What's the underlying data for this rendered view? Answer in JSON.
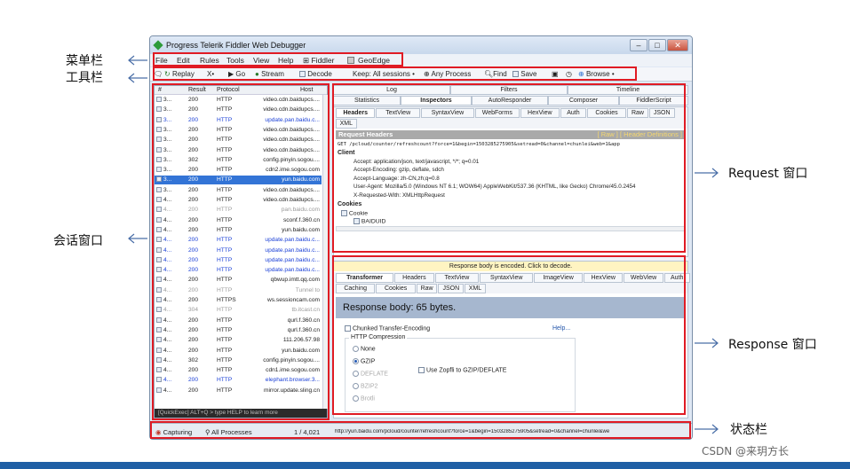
{
  "title": "Progress Telerik Fiddler Web Debugger",
  "menu": [
    "File",
    "Edit",
    "Rules",
    "Tools",
    "View",
    "Help",
    "⊞ Fiddler",
    "GeoEdge"
  ],
  "toolbar": {
    "replay": "Replay",
    "x": "X•",
    "go": "▶ Go",
    "stream": "Stream",
    "decode": "Decode",
    "keep": "Keep: All sessions •",
    "process": "Any Process",
    "find": "Find",
    "save": "Save",
    "browse": "Browse •"
  },
  "sessions_header": {
    "num": "#",
    "result": "Result",
    "protocol": "Protocol",
    "host": "Host"
  },
  "sessions": [
    {
      "id": "3...",
      "result": "200",
      "protocol": "HTTP",
      "host": "video.cdn.baidupcs....",
      "style": "n"
    },
    {
      "id": "3...",
      "result": "200",
      "protocol": "HTTP",
      "host": "video.cdn.baidupcs....",
      "style": "n"
    },
    {
      "id": "3...",
      "result": "200",
      "protocol": "HTTP",
      "host": "update.pan.baidu.c...",
      "style": "b"
    },
    {
      "id": "3...",
      "result": "200",
      "protocol": "HTTP",
      "host": "video.cdn.baidupcs....",
      "style": "n"
    },
    {
      "id": "3...",
      "result": "200",
      "protocol": "HTTP",
      "host": "video.cdn.baidupcs....",
      "style": "n"
    },
    {
      "id": "3...",
      "result": "200",
      "protocol": "HTTP",
      "host": "video.cdn.baidupcs....",
      "style": "n"
    },
    {
      "id": "3...",
      "result": "302",
      "protocol": "HTTP",
      "host": "config.pinyin.sogou....",
      "style": "n"
    },
    {
      "id": "3...",
      "result": "200",
      "protocol": "HTTP",
      "host": "cdn2.ime.sogou.com",
      "style": "n"
    },
    {
      "id": "3...",
      "result": "200",
      "protocol": "HTTP",
      "host": "yun.baidu.com",
      "style": "s"
    },
    {
      "id": "3...",
      "result": "200",
      "protocol": "HTTP",
      "host": "video.cdn.baidupcs....",
      "style": "n"
    },
    {
      "id": "4...",
      "result": "200",
      "protocol": "HTTP",
      "host": "video.cdn.baidupcs....",
      "style": "n"
    },
    {
      "id": "4...",
      "result": "200",
      "protocol": "HTTP",
      "host": "pan.baidu.com",
      "style": "g"
    },
    {
      "id": "4...",
      "result": "200",
      "protocol": "HTTP",
      "host": "sconf.f.360.cn",
      "style": "n"
    },
    {
      "id": "4...",
      "result": "200",
      "protocol": "HTTP",
      "host": "yun.baidu.com",
      "style": "n"
    },
    {
      "id": "4...",
      "result": "200",
      "protocol": "HTTP",
      "host": "update.pan.baidu.c...",
      "style": "b"
    },
    {
      "id": "4...",
      "result": "200",
      "protocol": "HTTP",
      "host": "update.pan.baidu.c...",
      "style": "b"
    },
    {
      "id": "4...",
      "result": "200",
      "protocol": "HTTP",
      "host": "update.pan.baidu.c...",
      "style": "b"
    },
    {
      "id": "4...",
      "result": "200",
      "protocol": "HTTP",
      "host": "update.pan.baidu.c...",
      "style": "b"
    },
    {
      "id": "4...",
      "result": "200",
      "protocol": "HTTP",
      "host": "qbwup.imtt.qq.com",
      "style": "n"
    },
    {
      "id": "4...",
      "result": "200",
      "protocol": "HTTP",
      "host": "Tunnel to",
      "style": "g"
    },
    {
      "id": "4...",
      "result": "200",
      "protocol": "HTTPS",
      "host": "ws.sessioncam.com",
      "style": "n"
    },
    {
      "id": "4...",
      "result": "304",
      "protocol": "HTTP",
      "host": "tb.itcast.cn",
      "style": "g"
    },
    {
      "id": "4...",
      "result": "200",
      "protocol": "HTTP",
      "host": "qurl.f.360.cn",
      "style": "n"
    },
    {
      "id": "4...",
      "result": "200",
      "protocol": "HTTP",
      "host": "qurl.f.360.cn",
      "style": "n"
    },
    {
      "id": "4...",
      "result": "200",
      "protocol": "HTTP",
      "host": "111.206.57.98",
      "style": "n"
    },
    {
      "id": "4...",
      "result": "200",
      "protocol": "HTTP",
      "host": "yun.baidu.com",
      "style": "n"
    },
    {
      "id": "4...",
      "result": "302",
      "protocol": "HTTP",
      "host": "config.pinyin.sogou....",
      "style": "n"
    },
    {
      "id": "4...",
      "result": "200",
      "protocol": "HTTP",
      "host": "cdn1.ime.sogou.com",
      "style": "n"
    },
    {
      "id": "4...",
      "result": "200",
      "protocol": "HTTP",
      "host": "elephant.browser.3...",
      "style": "b"
    },
    {
      "id": "4...",
      "result": "200",
      "protocol": "HTTP",
      "host": "mirror.update.sling.cn",
      "style": "n"
    }
  ],
  "quickexec": "[QuickExec] ALT+Q > type HELP to learn more",
  "top_tabs": [
    "Log",
    "Filters",
    "Timeline"
  ],
  "tabs2": [
    "Statistics",
    "Inspectors",
    "AutoResponder",
    "Composer",
    "FiddlerScript"
  ],
  "req_tabs": [
    "Headers",
    "TextView",
    "SyntaxView",
    "WebForms",
    "HexView",
    "Auth",
    "Cookies",
    "Raw",
    "JSON"
  ],
  "req_tabs2": [
    "XML"
  ],
  "req_headers_title": "Request Headers",
  "req_headers_links": "[ Raw ]  [ Header Definitions ]",
  "req_line": "GET /pcloud/counter/refreshcount?force=1&begin=1503285275905&setread=0&channel=chunlei&web=1&app",
  "client_label": "Client",
  "client_lines": [
    "Accept: application/json, text/javascript, */*; q=0.01",
    "Accept-Encoding: gzip, deflate, sdch",
    "Accept-Language: zh-CN,zh;q=0.8",
    "User-Agent: Mozilla/5.0 (Windows NT 6.1; WOW64) AppleWebKit/537.36 (KHTML, like Gecko) Chrome/45.0.2454",
    "X-Requested-With: XMLHttpRequest"
  ],
  "cookies_label": "Cookies",
  "cookie_items": [
    "Cookie",
    "BAIDUID"
  ],
  "encoded_msg": "Response body is encoded. Click to decode.",
  "resp_tabs": [
    "Transformer",
    "Headers",
    "TextView",
    "SyntaxView",
    "ImageView",
    "HexView",
    "WebView",
    "Auth"
  ],
  "resp_tabs2": [
    "Caching",
    "Cookies",
    "Raw",
    "JSON",
    "XML"
  ],
  "resp_body": "Response body: 65 bytes.",
  "chunked": "Chunked Transfer-Encoding",
  "help": "Help...",
  "compression_title": "HTTP Compression",
  "compression_opts": [
    "None",
    "GZIP",
    "DEFLATE",
    "BZIP2",
    "Brotli"
  ],
  "zopfli": "Use Zopfli to GZIP/DEFLATE",
  "status": {
    "capturing": "Capturing",
    "processes": "All Processes",
    "count": "1 / 4,021",
    "url": "http://yun.baidu.com/pcloud/counter/refreshcount?force=1&begin=1503285275905&setread=0&channel=chunlei&we"
  },
  "annotations": {
    "menubar": "菜单栏",
    "toolbar": "工具栏",
    "session": "会话窗口",
    "request": "Request 窗口",
    "response": "Response 窗口",
    "status": "状态栏"
  },
  "watermark": "CSDN @来玥方长",
  "colors": {
    "red_box": "#e01b24",
    "selection": "#3374d6",
    "bottom_bar": "#1f5fa5"
  }
}
